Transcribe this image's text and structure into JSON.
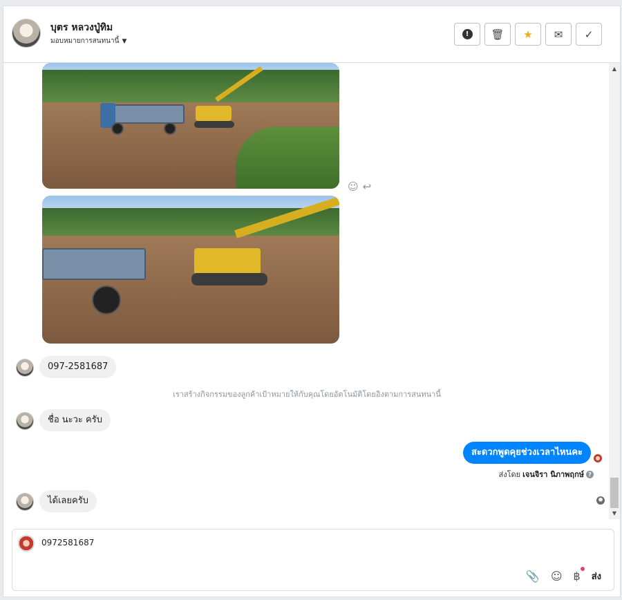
{
  "header": {
    "contact_name": "บุตร หลวงปู่ทิม",
    "assign_label": "มอบหมายการสนทนานี้",
    "actions": [
      {
        "name": "spam-button",
        "icon": "!"
      },
      {
        "name": "delete-button",
        "icon": "🗑"
      },
      {
        "name": "star-button",
        "icon": "★"
      },
      {
        "name": "mark-unread-button",
        "icon": "✉"
      },
      {
        "name": "mark-done-button",
        "icon": "✓"
      }
    ]
  },
  "thread": {
    "messages": [
      {
        "text": "097-2581687"
      },
      {
        "text": "ชื่อ  นะวะ  ครับ"
      },
      {
        "text": "ได้เลยครับ"
      }
    ],
    "system_note": "เราสร้างกิจกรรมของลูกค้าเป้าหมายให้กับคุณโดยอัตโนมัติโดยอิงตามการสนทนานี้",
    "outgoing": "สะดวกพูดคุยช่วงเวลาไหนคะ",
    "sent_by_prefix": "ส่งโดย",
    "sent_by_name": "เจนจิรา นิภาพฤกษ์"
  },
  "composer": {
    "value": "0972581687",
    "send_label": "ส่ง"
  },
  "colors": {
    "accent": "#0084ff",
    "star": "#f5a623",
    "notify": "#e4405f"
  }
}
